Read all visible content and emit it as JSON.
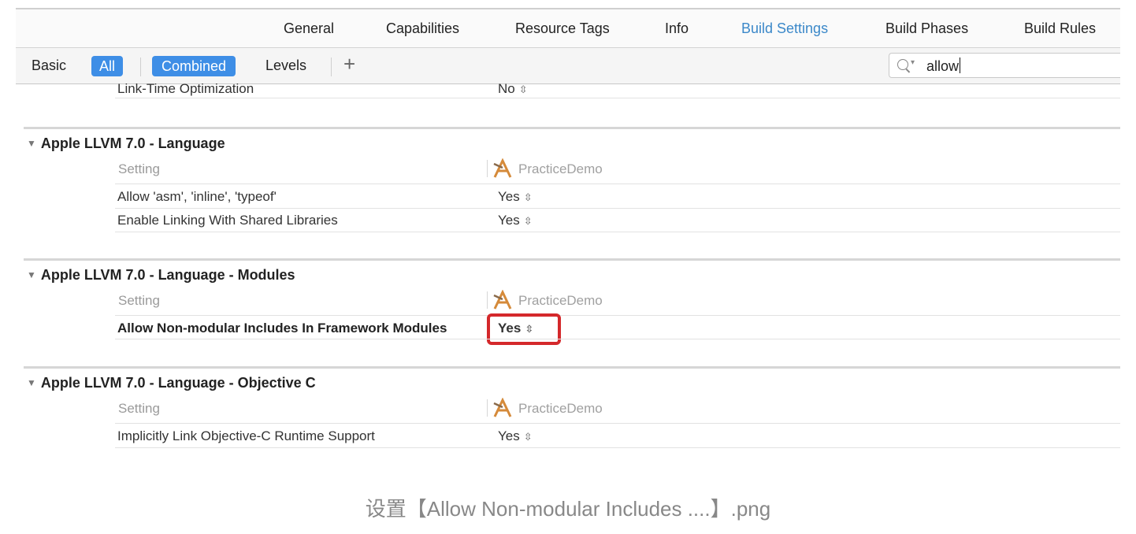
{
  "tabs": [
    "General",
    "Capabilities",
    "Resource Tags",
    "Info",
    "Build Settings",
    "Build Phases",
    "Build Rules"
  ],
  "active_tab": "Build Settings",
  "filters": {
    "basic": "Basic",
    "all": "All",
    "combined": "Combined",
    "levels": "Levels",
    "add": "+"
  },
  "search": {
    "value": "allow"
  },
  "top_row": {
    "setting": "Link-Time Optimization",
    "value": "No"
  },
  "sections": [
    {
      "title": "Apple LLVM 7.0 - Language",
      "header_setting": "Setting",
      "header_target": "PracticeDemo",
      "rows": [
        {
          "setting": "Allow 'asm', 'inline', 'typeof'",
          "value": "Yes"
        },
        {
          "setting": "Enable Linking With Shared Libraries",
          "value": "Yes"
        }
      ]
    },
    {
      "title": "Apple LLVM 7.0 - Language - Modules",
      "header_setting": "Setting",
      "header_target": "PracticeDemo",
      "rows": [
        {
          "setting": "Allow Non-modular Includes In Framework Modules",
          "value": "Yes"
        }
      ]
    },
    {
      "title": "Apple LLVM 7.0 - Language - Objective C",
      "header_setting": "Setting",
      "header_target": "PracticeDemo",
      "rows": [
        {
          "setting": "Implicitly Link Objective-C Runtime Support",
          "value": "Yes"
        }
      ]
    }
  ],
  "stepper_glyph": "⇳",
  "disclosure_glyph": "▼",
  "caption": "设置【Allow Non-modular Includes ....】.png",
  "colors": {
    "accent": "#3e8ee6",
    "highlight": "#d4282b",
    "active_tab": "#3b88c9"
  }
}
